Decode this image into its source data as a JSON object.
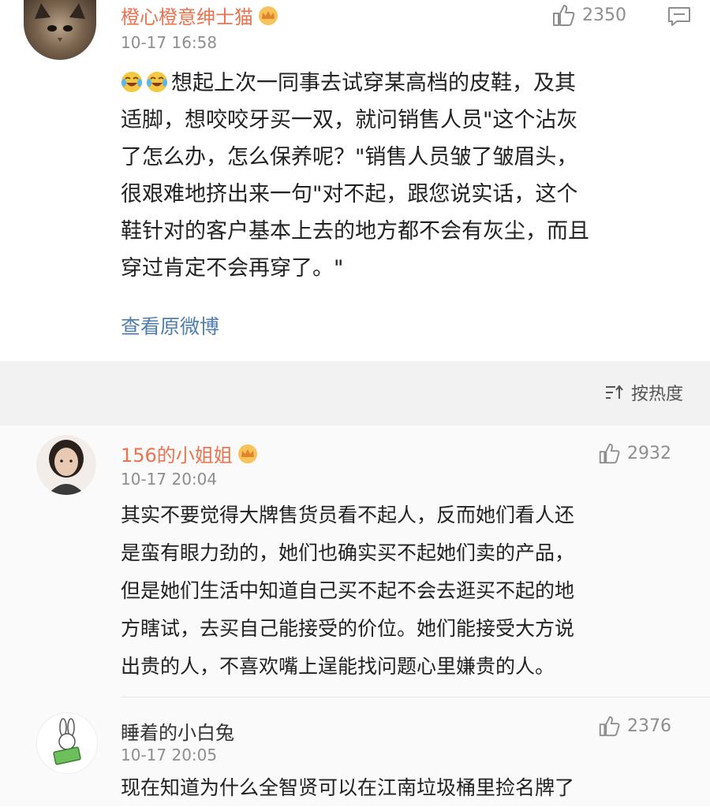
{
  "post": {
    "author": "橙心橙意绅士猫",
    "time": "10-17 16:58",
    "likes": "2350",
    "lines": [
      "想起上次一同事去试穿某高档的皮鞋，及其",
      "适脚，想咬咬牙买一双，就问销售人员\"这个沾灰",
      "了怎么办，怎么保养呢？\"销售人员皱了皱眉头，",
      "很艰难地挤出来一句\"对不起，跟您说实话，这个",
      "鞋针对的客户基本上去的地方都不会有灰尘，而且",
      "穿过肯定不会再穿了。\""
    ],
    "view_original": "查看原微博"
  },
  "sort": {
    "label": "按热度"
  },
  "comments": [
    {
      "author": "156的小姐姐",
      "time": "10-17 20:04",
      "likes": "2932",
      "lines": [
        "其实不要觉得大牌售货员看不起人，反而她们看人还",
        "是蛮有眼力劲的，她们也确实买不起她们卖的产品，",
        "但是她们生活中知道自己买不起不会去逛买不起的地",
        "方瞎试，去买自己能接受的价位。她们能接受大方说",
        "出贵的人，不喜欢嘴上逞能找问题心里嫌贵的人。"
      ]
    },
    {
      "author": "睡着的小白兔",
      "time": "10-17 20:05",
      "likes": "2376",
      "lines": [
        "现在知道为什么全智贤可以在江南垃圾桶里捡名牌了"
      ]
    }
  ],
  "colors": {
    "username_orange": "#eb7350",
    "link_blue": "#507daf",
    "meta_gray": "#8e8e8e"
  }
}
